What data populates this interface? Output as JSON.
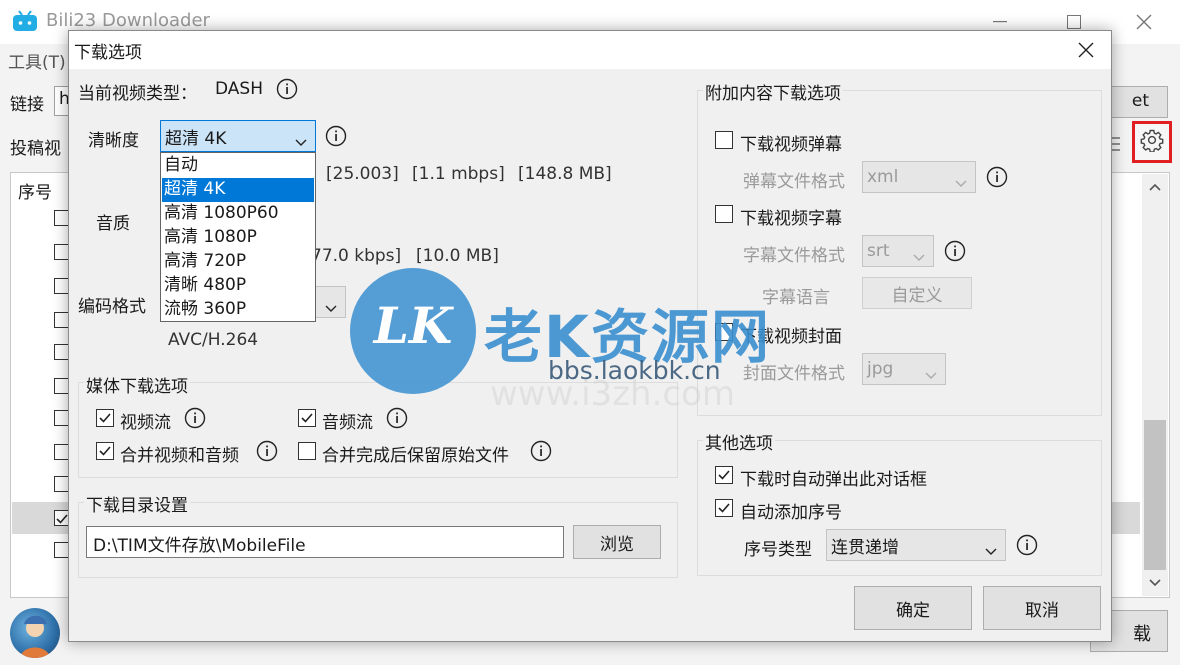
{
  "app": {
    "title": "Bili23 Downloader",
    "menu_tools": "工具(T)",
    "link_label": "链接",
    "link_value": "h",
    "get_button": "et",
    "contrib_label": "投稿视",
    "col_index": "序号",
    "download_button": "载"
  },
  "dialog": {
    "title": "下载选项",
    "video_type_label": "当前视频类型：",
    "video_type_value": "DASH",
    "quality_label": "清晰度",
    "quality_selected": "超清 4K",
    "quality_options": [
      "自动",
      "超清 4K",
      "高清 1080P60",
      "高清 1080P",
      "高清 720P",
      "清晰 480P",
      "流畅 360P"
    ],
    "video_info": {
      "fps": "[25.003]",
      "bitrate": "[1.1 mbps]",
      "size": "[148.8 MB]"
    },
    "audio_label": "音质",
    "audio_info": {
      "bitrate": "77.0 kbps]",
      "size": "[10.0 MB]"
    },
    "codec_label": "编码格式",
    "codec_value": "AVC/H.264",
    "media_group": {
      "title": "媒体下载选项",
      "video_stream": "视频流",
      "audio_stream": "音频流",
      "merge": "合并视频和音频",
      "keep_original": "合并完成后保留原始文件"
    },
    "dir_group": {
      "title": "下载目录设置",
      "path": "D:\\TIM文件存放\\MobileFile",
      "browse": "浏览"
    },
    "extra_group": {
      "title": "附加内容下载选项",
      "danmaku": "下载视频弹幕",
      "danmaku_format_label": "弹幕文件格式",
      "danmaku_format": "xml",
      "subtitle": "下载视频字幕",
      "subtitle_format_label": "字幕文件格式",
      "subtitle_format": "srt",
      "subtitle_lang_label": "字幕语言",
      "subtitle_lang_button": "自定义",
      "cover": "下载视频封面",
      "cover_format_label": "封面文件格式",
      "cover_format": "jpg"
    },
    "other_group": {
      "title": "其他选项",
      "auto_popup": "下载时自动弹出此对话框",
      "auto_index": "自动添加序号",
      "index_type_label": "序号类型",
      "index_type": "连贯递增"
    },
    "ok_button": "确定",
    "cancel_button": "取消"
  },
  "watermark": {
    "logo_letters": "LK",
    "title": "老K资源网",
    "url": "bbs.laokbk.cn",
    "faint_url": "www.i3zh.com"
  },
  "colors": {
    "accent": "#0078d7",
    "highlight_box": "#e02020",
    "watermark_blue": "#3a8fd0"
  }
}
